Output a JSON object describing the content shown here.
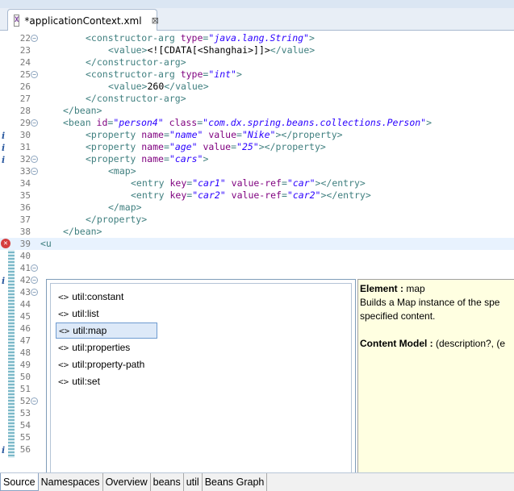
{
  "editor_tab": {
    "title": "*applicationContext.xml",
    "icon": "xml-file-icon",
    "close": "⊠"
  },
  "code_lines": [
    {
      "num": "22",
      "marker": "fold",
      "indent": 8,
      "parts": [
        [
          "t",
          "<constructor-arg "
        ],
        [
          "a",
          "type"
        ],
        [
          "t",
          "="
        ],
        [
          "v",
          "\"java.lang.String\""
        ],
        [
          "t",
          ">"
        ]
      ]
    },
    {
      "num": "23",
      "marker": "",
      "indent": 12,
      "parts": [
        [
          "t",
          "<value>"
        ],
        [
          "x",
          "<![CDATA[<Shanghai>]]>"
        ],
        [
          "t",
          "</value>"
        ]
      ]
    },
    {
      "num": "24",
      "marker": "",
      "indent": 8,
      "parts": [
        [
          "t",
          "</constructor-arg>"
        ]
      ]
    },
    {
      "num": "25",
      "marker": "fold",
      "indent": 8,
      "parts": [
        [
          "t",
          "<constructor-arg "
        ],
        [
          "a",
          "type"
        ],
        [
          "t",
          "="
        ],
        [
          "v",
          "\"int\""
        ],
        [
          "t",
          ">"
        ]
      ]
    },
    {
      "num": "26",
      "marker": "",
      "indent": 12,
      "parts": [
        [
          "t",
          "<value>"
        ],
        [
          "x",
          "260"
        ],
        [
          "t",
          "</value>"
        ]
      ]
    },
    {
      "num": "27",
      "marker": "",
      "indent": 8,
      "parts": [
        [
          "t",
          "</constructor-arg>"
        ]
      ]
    },
    {
      "num": "28",
      "marker": "",
      "indent": 4,
      "parts": [
        [
          "t",
          "</bean>"
        ]
      ]
    },
    {
      "num": "29",
      "marker": "fold",
      "indent": 4,
      "parts": [
        [
          "t",
          "<bean "
        ],
        [
          "a",
          "id"
        ],
        [
          "t",
          "="
        ],
        [
          "v",
          "\"person4\""
        ],
        [
          "t",
          " "
        ],
        [
          "a",
          "class"
        ],
        [
          "t",
          "="
        ],
        [
          "v",
          "\"com.dx.spring.beans.collections.Person\""
        ],
        [
          "t",
          ">"
        ]
      ]
    },
    {
      "num": "30",
      "marker": "info",
      "indent": 8,
      "parts": [
        [
          "t",
          "<property "
        ],
        [
          "a",
          "name"
        ],
        [
          "t",
          "="
        ],
        [
          "v",
          "\"name\""
        ],
        [
          "t",
          " "
        ],
        [
          "a",
          "value"
        ],
        [
          "t",
          "="
        ],
        [
          "v",
          "\"Nike\""
        ],
        [
          "t",
          "></property>"
        ]
      ]
    },
    {
      "num": "31",
      "marker": "info",
      "indent": 8,
      "parts": [
        [
          "t",
          "<property "
        ],
        [
          "a",
          "name"
        ],
        [
          "t",
          "="
        ],
        [
          "v",
          "\"age\""
        ],
        [
          "t",
          " "
        ],
        [
          "a",
          "value"
        ],
        [
          "t",
          "="
        ],
        [
          "v",
          "\"25\""
        ],
        [
          "t",
          "></property>"
        ]
      ]
    },
    {
      "num": "32",
      "marker": "info-fold",
      "indent": 8,
      "parts": [
        [
          "t",
          "<property "
        ],
        [
          "a",
          "name"
        ],
        [
          "t",
          "="
        ],
        [
          "v",
          "\"cars\""
        ],
        [
          "t",
          ">"
        ]
      ]
    },
    {
      "num": "33",
      "marker": "fold",
      "indent": 12,
      "parts": [
        [
          "t",
          "<map>"
        ]
      ]
    },
    {
      "num": "34",
      "marker": "",
      "indent": 16,
      "parts": [
        [
          "t",
          "<entry "
        ],
        [
          "a",
          "key"
        ],
        [
          "t",
          "="
        ],
        [
          "v",
          "\"car1\""
        ],
        [
          "t",
          " "
        ],
        [
          "a",
          "value-ref"
        ],
        [
          "t",
          "="
        ],
        [
          "v",
          "\"car\""
        ],
        [
          "t",
          "></entry>"
        ]
      ]
    },
    {
      "num": "35",
      "marker": "",
      "indent": 16,
      "parts": [
        [
          "t",
          "<entry "
        ],
        [
          "a",
          "key"
        ],
        [
          "t",
          "="
        ],
        [
          "v",
          "\"car2\""
        ],
        [
          "t",
          " "
        ],
        [
          "a",
          "value-ref"
        ],
        [
          "t",
          "="
        ],
        [
          "v",
          "\"car2\""
        ],
        [
          "t",
          "></entry>"
        ]
      ]
    },
    {
      "num": "36",
      "marker": "",
      "indent": 12,
      "parts": [
        [
          "t",
          "</map>"
        ]
      ]
    },
    {
      "num": "37",
      "marker": "",
      "indent": 8,
      "parts": [
        [
          "t",
          "</property>"
        ]
      ]
    },
    {
      "num": "38",
      "marker": "",
      "indent": 4,
      "parts": [
        [
          "t",
          "</bean>"
        ]
      ]
    },
    {
      "num": "39",
      "marker": "error",
      "indent": 0,
      "current": true,
      "parts": [
        [
          "t",
          "<u"
        ]
      ]
    },
    {
      "num": "40",
      "marker": "",
      "indent": 0,
      "parts": []
    },
    {
      "num": "41",
      "marker": "fold",
      "indent": 0,
      "parts": []
    },
    {
      "num": "42",
      "marker": "info-fold",
      "indent": 0,
      "parts": []
    },
    {
      "num": "43",
      "marker": "fold",
      "indent": 0,
      "parts": []
    },
    {
      "num": "44",
      "marker": "",
      "indent": 0,
      "parts": []
    },
    {
      "num": "45",
      "marker": "",
      "indent": 0,
      "parts": []
    },
    {
      "num": "46",
      "marker": "",
      "indent": 0,
      "parts": []
    },
    {
      "num": "47",
      "marker": "",
      "indent": 0,
      "parts": []
    },
    {
      "num": "48",
      "marker": "",
      "indent": 0,
      "parts": []
    },
    {
      "num": "49",
      "marker": "",
      "indent": 0,
      "parts": []
    },
    {
      "num": "50",
      "marker": "",
      "indent": 0,
      "parts": []
    },
    {
      "num": "51",
      "marker": "",
      "indent": 0,
      "parts": []
    },
    {
      "num": "52",
      "marker": "fold",
      "indent": 0,
      "parts": []
    },
    {
      "num": "53",
      "marker": "",
      "indent": 0,
      "parts": []
    },
    {
      "num": "54",
      "marker": "",
      "indent": 0,
      "parts": []
    },
    {
      "num": "55",
      "marker": "",
      "indent": 0,
      "parts": []
    },
    {
      "num": "56",
      "marker": "info",
      "indent": 0,
      "parts": []
    }
  ],
  "content_assist": {
    "proposals": [
      {
        "icon": "<>",
        "label": "util:constant",
        "selected": false
      },
      {
        "icon": "<>",
        "label": "util:list",
        "selected": false
      },
      {
        "icon": "<>",
        "label": "util:map",
        "selected": true
      },
      {
        "icon": "<>",
        "label": "util:properties",
        "selected": false
      },
      {
        "icon": "<>",
        "label": "util:property-path",
        "selected": false
      },
      {
        "icon": "<>",
        "label": "util:set",
        "selected": false
      }
    ]
  },
  "doc_popup": {
    "element_label": "Element : ",
    "element_value": "map",
    "line1": "Builds a Map instance of the spe",
    "line2": " specified content.",
    "model_label": "Content Model : ",
    "model_value": "(description?, (e"
  },
  "bottom_tabs": [
    {
      "label": "Source",
      "active": true
    },
    {
      "label": "Namespaces",
      "active": false
    },
    {
      "label": "Overview",
      "active": false
    },
    {
      "label": "beans",
      "active": false
    },
    {
      "label": "util",
      "active": false
    },
    {
      "label": "Beans Graph",
      "active": false
    }
  ]
}
